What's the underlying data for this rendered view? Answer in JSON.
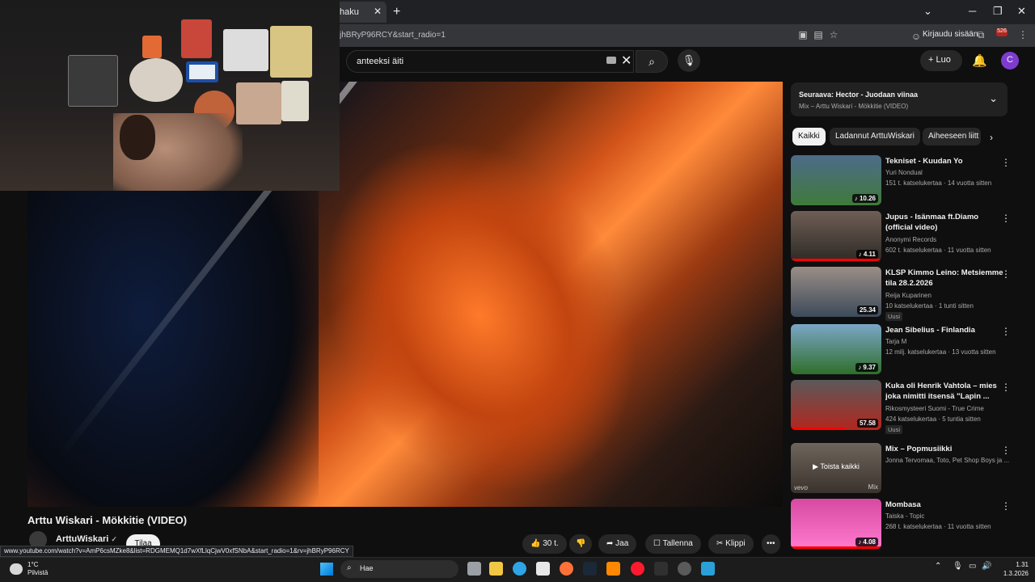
{
  "browser": {
    "tab_title": "haku",
    "tab_close": "✕",
    "new_tab": "+",
    "url": "jhBRyP96RCY&start_radio=1",
    "signin": "Kirjaudu sisään",
    "ext_badge": "526",
    "win_min": "─",
    "win_max": "❐",
    "win_close": "✕",
    "dropdown": "⌄"
  },
  "header": {
    "search_value": "anteeksi äiti",
    "clear": "✕",
    "search_icon": "⌕",
    "mic_icon": "🎙",
    "create": "+ Luo",
    "bell": "🔔",
    "avatar_letter": "C"
  },
  "video": {
    "title": "Arttu Wiskari - Mökkitie (VIDEO)",
    "channel": "ArttuWiskari",
    "verified": "✓",
    "subscribe": "Tilaa",
    "likes": "👍 30 t.",
    "dislike": "👎",
    "share": "➦ Jaa",
    "save": "☐ Tallenna",
    "clip": "✂ Klippi",
    "more": "•••"
  },
  "status_url": "www.youtube.com/watch?v=AmP6csMZke8&list=RDGMEMQ1d7wXfLlqCjwV0xfSNbA&start_radio=1&rv=jhBRyP96RCY",
  "upnext": {
    "title": "Seuraava: Hector - Juodaan viinaa",
    "sub": "Mix – Arttu Wiskari - Mökkitie (VIDEO)",
    "chevron": "⌄"
  },
  "chips": [
    "Kaikki",
    "Ladannut ArttuWiskari",
    "Aiheeseen liitt"
  ],
  "chip_arrow": "›",
  "recommendations": [
    {
      "title": "Tekniset - Kuudan Yo",
      "channel": "Yuri Nondual",
      "stats": "151 t. katselukertaa · 14 vuotta sitten",
      "duration": "♪ 10.26",
      "badge": "",
      "colors": [
        "#4d6b8a",
        "#3f7a3a"
      ],
      "progress": 0
    },
    {
      "title": "Jupus - Isänmaa ft.Diamo (official video)",
      "channel": "Anonymi Records",
      "stats": "602 t. katselukertaa · 11 vuotta sitten",
      "duration": "♪ 4.11",
      "badge": "",
      "colors": [
        "#6f5f55",
        "#2e2a26"
      ],
      "progress": 1.0
    },
    {
      "title": "KLSP Kimmo Leino: Metsiemme tila 28.2.2026",
      "channel": "Reija Kuparinen",
      "stats": "10 katselukertaa · 1 tunti sitten",
      "duration": "25.34",
      "badge": "Uusi",
      "colors": [
        "#9a8e86",
        "#3d4a5a"
      ],
      "progress": 0
    },
    {
      "title": "Jean Sibelius - Finlandia",
      "channel": "Tarja M",
      "stats": "12 milj. katselukertaa · 13 vuotta sitten",
      "duration": "♪ 9.37",
      "badge": "",
      "colors": [
        "#7aa6c8",
        "#2f6e2a"
      ],
      "progress": 0
    },
    {
      "title": "Kuka oli Henrik Vahtola – mies joka nimitti itsensä \"Lapin ...",
      "channel": "Rikosmysteeri Suomi - True Crime",
      "stats": "424 katselukertaa · 5 tuntia sitten",
      "duration": "57.58",
      "badge": "Uusi",
      "colors": [
        "#5a5a5a",
        "#b3261e"
      ],
      "progress": 0.6
    },
    {
      "title": "Mix – Popmusiikki",
      "channel": "Jonna Tervomaa, Toto, Pet Shop Boys ja ...",
      "stats": "",
      "duration": "",
      "badge": "",
      "colors": [
        "#c9b8a8",
        "#6a5c52"
      ],
      "progress": 0,
      "overlay": "▶  Toista kaikki",
      "mix_label": "Mix",
      "vevo": "vevo"
    },
    {
      "title": "Mombasa",
      "channel": "Taiska - Topic",
      "stats": "268 t. katselukertaa · 11 vuotta sitten",
      "duration": "♪ 4.08",
      "badge": "",
      "colors": [
        "#d64aa0",
        "#ff7ad0"
      ],
      "progress": 1.0
    }
  ],
  "rec_more": "⋮",
  "taskbar": {
    "temp": "1°C",
    "weather": "Pilvistä",
    "search": "Hae",
    "time": "1.31",
    "date": "1.3.2026",
    "tray_up": "⌃",
    "tray_mic": "🎙",
    "tray_net": "▭",
    "tray_vol": "🔊"
  }
}
